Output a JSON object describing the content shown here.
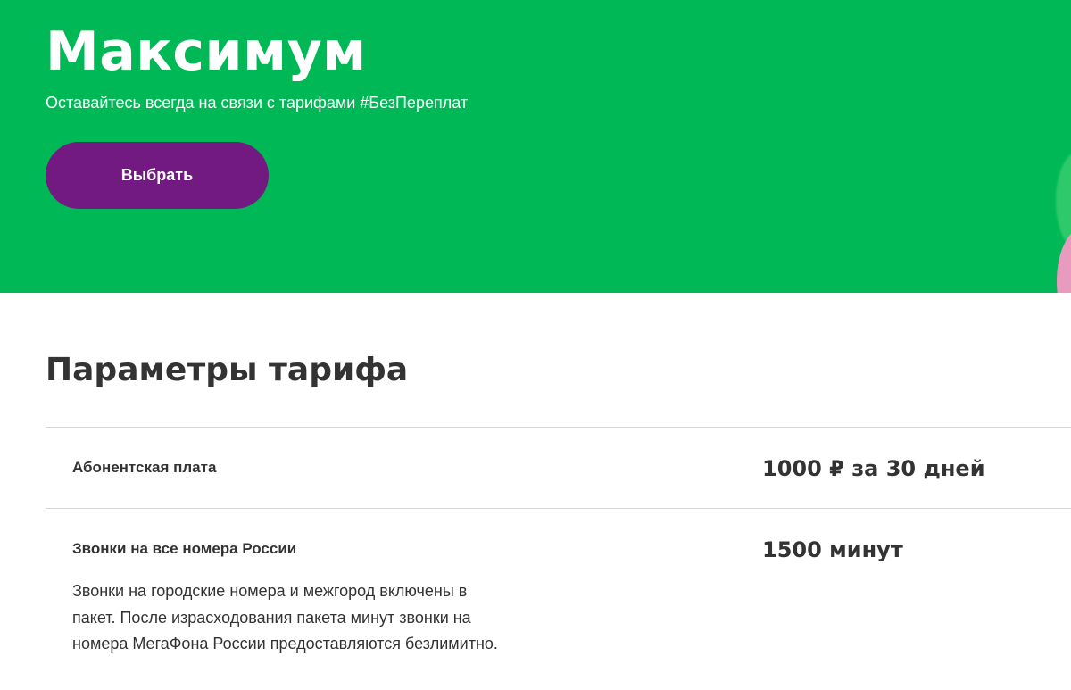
{
  "hero": {
    "title": "Максимум",
    "subtitle": "Оставайтесь всегда на связи с тарифами #БезПереплат",
    "button_label": "Выбрать"
  },
  "params": {
    "title": "Параметры тарифа",
    "rows": [
      {
        "label": "Абонентская плата",
        "value": "1000 ₽ за 30 дней"
      },
      {
        "label": "Звонки на все номера России",
        "value": "1500 минут",
        "description": "Звонки на городские номера и межгород включены в пакет. После израсходования пакета минут звонки на номера МегаФона России предоставляются безлимитно."
      }
    ]
  },
  "colors": {
    "brand_green": "#00b956",
    "brand_purple": "#731982",
    "text_dark": "#333333",
    "divider": "#d8d8d8"
  }
}
